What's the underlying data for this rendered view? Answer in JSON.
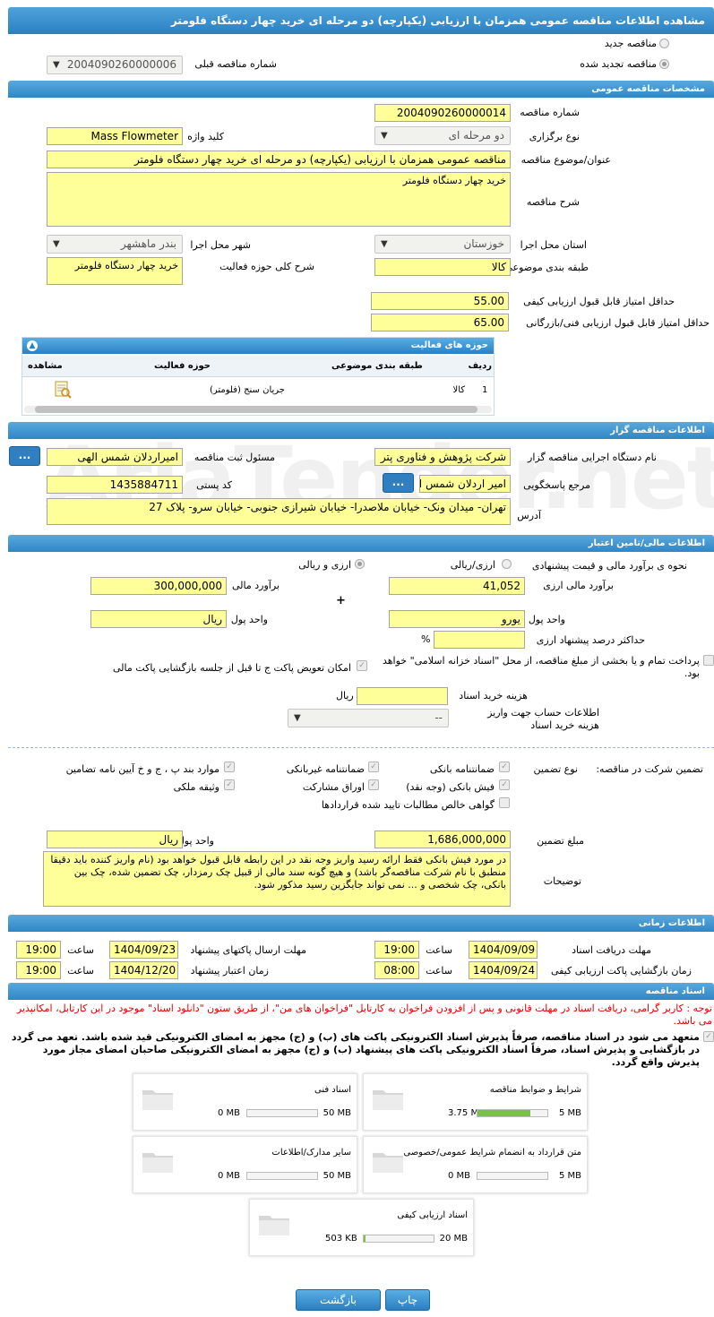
{
  "title": "مشاهده اطلاعات مناقصه عمومی همزمان با ارزیابی (یکپارچه) دو مرحله ای خرید چهار دستگاه فلومتر",
  "top": {
    "new_label": "مناقصه جدید",
    "renewed_label": "مناقصه تجدید شده",
    "prev_label": "شماره مناقصه قبلی",
    "prev_value": "2004090260000006"
  },
  "general": {
    "header": "مشخصات مناقصه عمومی",
    "number_label": "شماره مناقصه",
    "number": "2004090260000014",
    "type_label": "نوع برگزاری",
    "type": "دو مرحله ای",
    "keyword_label": "کلید واژه",
    "keyword": "Mass Flowmeter",
    "subject_label": "عنوان/موضوع مناقصه",
    "subject": "مناقصه عمومی همزمان با ارزیابی (یکپارچه) دو مرحله ای خرید چهار دستگاه فلومتر",
    "desc_label": "شرح مناقصه",
    "desc": "خرید چهار دستگاه فلومتر",
    "province_label": "استان محل اجرا",
    "province": "خوزستان",
    "city_label": "شهر محل اجرا",
    "city": "بندر ماهشهر",
    "category_label": "طبقه بندی موضوعی",
    "category": "کالا",
    "scope_label": "شرح کلی حوزه فعالیت",
    "scope": "خرید چهار دستگاه فلومتر",
    "minq_label": "حداقل امتیاز قابل قبول ارزیابی کیفی",
    "minq": "55.00",
    "mint_label": "حداقل امتیاز قابل قبول ارزیابی فنی/بازرگانی",
    "mint": "65.00"
  },
  "activity": {
    "header": "حوزه های فعالیت",
    "cols": [
      "ردیف",
      "طبقه بندی موضوعی",
      "حوزه فعالیت",
      "مشاهده"
    ],
    "rows": [
      {
        "n": "1",
        "cat": "کالا",
        "field": "جریان سنج (فلومتر)"
      }
    ]
  },
  "org": {
    "header": "اطلاعات مناقصه گزار",
    "exec_label": "نام دستگاه اجرایی مناقصه گزار",
    "exec": "شرکت پژوهش و فناوری پتر",
    "resp_label": "مسئول ثبت مناقصه",
    "resp": "امیراردلان شمس الهی",
    "ref_label": "مرجع پاسخگویی",
    "ref": "امیر اردلان شمس ا",
    "postal_label": "کد پستی",
    "postal": "1435884711",
    "addr_label": "آدرس",
    "addr": "تهران- میدان ونک- خیابان ملاصدرا- خیابان شیرازی جنوبی- خیابان سرو- پلاک 27",
    "btn": "..."
  },
  "fin": {
    "header": "اطلاعات مالی/تامین اعتبار",
    "method_label": "نحوه ی برآورد مالی و قیمت پیشنهادی",
    "opt_fx": "ارزی/ریالی",
    "opt_both": "ارزی و ریالی",
    "fx_est_label": "برآورد مالی ارزی",
    "fx_est": "41,052",
    "rial_est_label": "برآورد مالی",
    "rial_est": "300,000,000",
    "plus": "+",
    "fx_unit_label": "واحد پول",
    "fx_unit": "یورو",
    "rial_unit_label": "واحد پول",
    "rial_unit": "ریال",
    "max_fx_label": "حداکثر درصد پیشنهاد ارزی",
    "pct": "%",
    "treasury": "پرداخت تمام و یا بخشی از مبلغ مناقصه، از محل \"اسناد خزانه اسلامی\" خواهد بود.",
    "swap": "امکان تعویض پاکت ج تا قبل از جلسه بازگشایی پاکت مالی",
    "doc_cost_label": "هزینه خرید اسناد",
    "doc_cost_unit": "ریال",
    "acct_label": "اطلاعات حساب جهت واریز هزینه خرید اسناد",
    "acct": "--"
  },
  "guar": {
    "label": "تضمین شرکت در مناقصه:",
    "type_label": "نوع تضمین",
    "items": [
      "ضمانتنامه بانکی",
      "ضمانتنامه غیربانکی",
      "موارد بند پ ، ج و خ آیین نامه تضامین",
      "فیش بانکی (وجه نقد)",
      "اوراق مشارکت",
      "وثیقه ملکی",
      "گواهی خالص مطالبات تایید شده قراردادها"
    ],
    "amount_label": "مبلغ تضمین",
    "amount": "1,686,000,000",
    "unit_label": "واحد پول",
    "unit": "ریال",
    "notes_label": "توضیحات",
    "notes": "در مورد فیش بانکی فقط ارائه رسید واریز وجه نقد در این رابطه قابل قبول خواهد بود (نام واریز کننده باید دقیقا منطبق با نام شرکت مناقصه‌گر باشد) و هیچ گونه سند مالی از قبیل چک رمزدار، چک تضمین شده، چک بین بانکی، چک شخصی و ... نمی تواند جایگزین رسید مذکور شود."
  },
  "time": {
    "header": "اطلاعات زمانی",
    "recv_label": "مهلت دریافت اسناد",
    "recv_date": "1404/09/09",
    "recv_time": "19:00",
    "send_label": "مهلت ارسال پاکتهای پیشنهاد",
    "send_date": "1404/09/23",
    "send_time": "19:00",
    "open_label": "زمان بازگشایی پاکت ارزیابی کیفی",
    "open_date": "1404/09/24",
    "open_time": "08:00",
    "valid_label": "زمان اعتبار پیشنهاد",
    "valid_date": "1404/12/20",
    "valid_time": "19:00",
    "hour_label": "ساعت"
  },
  "docs": {
    "header": "اسناد مناقصه",
    "note": "توجه : کاربر گرامی، دریافت اسناد در مهلت قانونی و پس از افزودن فراخوان به کارتابل \"فراخوان های من\"، از طریق ستون \"دانلود اسناد\" موجود در این کارتابل، امکانپذیر می باشد.",
    "commit": "متعهد می شود در اسناد مناقصه، صرفاً پذیرش اسناد الکترونیکی پاکت های (ب) و (ج) مجهز به امضای الکترونیکی قید شده باشد. تعهد می گردد در بازگشایی و پذیرش اسناد، صرفاً اسناد الکترونیکی پاکت های پیشنهاد (ب) و (ج) مجهز به امضای الکترونیکی صاحبان امضای مجاز مورد پذیرش واقع گردد.",
    "files": [
      {
        "title": "شرایط و ضوابط مناقصه",
        "current": "3.75 MB",
        "max": "5 MB",
        "pct": 0.75
      },
      {
        "title": "اسناد فنی",
        "current": "0 MB",
        "max": "50 MB",
        "pct": 0
      },
      {
        "title": "متن قرارداد به انضمام شرایط عمومی/خصوصی",
        "current": "0 MB",
        "max": "5 MB",
        "pct": 0
      },
      {
        "title": "سایر مدارک/اطلاعات",
        "current": "0 MB",
        "max": "50 MB",
        "pct": 0
      },
      {
        "title": "اسناد ارزیابی کیفی",
        "current": "503 KB",
        "max": "20 MB",
        "pct": 0.025
      }
    ]
  },
  "actions": {
    "print": "چاپ",
    "back": "بازگشت"
  },
  "watermark": "AriaTender.net"
}
